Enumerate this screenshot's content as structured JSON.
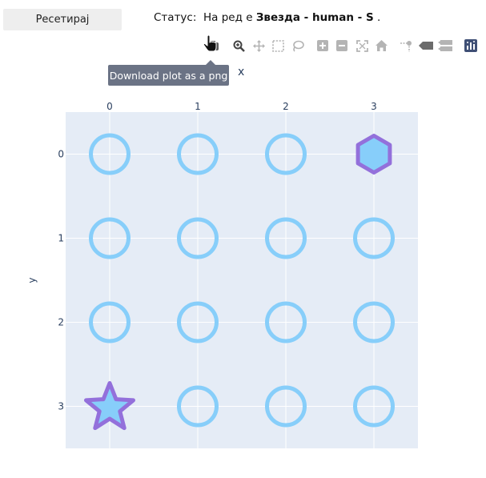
{
  "reset_button": {
    "label": "Ресетирај"
  },
  "status": {
    "prefix": "Статус:",
    "middle": "На ред е",
    "player": "Звезда - human - S",
    "suffix": "."
  },
  "modebar": {
    "buttons": [
      {
        "name": "camera-icon",
        "title": "Download plot as a png"
      },
      {
        "name": "zoom-icon",
        "title": "Zoom"
      },
      {
        "name": "pan-icon",
        "title": "Pan"
      },
      {
        "name": "box-select-icon",
        "title": "Box Select"
      },
      {
        "name": "lasso-select-icon",
        "title": "Lasso Select"
      },
      {
        "name": "zoom-in-icon",
        "title": "Zoom in"
      },
      {
        "name": "zoom-out-icon",
        "title": "Zoom out"
      },
      {
        "name": "autoscale-icon",
        "title": "Autoscale"
      },
      {
        "name": "reset-axes-icon",
        "title": "Reset axes"
      },
      {
        "name": "spike-lines-icon",
        "title": "Toggle Spike Lines"
      },
      {
        "name": "hover-closest-icon",
        "title": "Show closest data on hover"
      },
      {
        "name": "hover-compare-icon",
        "title": "Compare data on hover"
      },
      {
        "name": "plotly-logo-icon",
        "title": "Produced with Plotly"
      }
    ]
  },
  "tooltip": {
    "text": "Download plot as a png"
  },
  "chart_data": {
    "type": "scatter",
    "xlabel": "x",
    "ylabel": "y",
    "x_ticks": [
      "0",
      "1",
      "2",
      "3"
    ],
    "y_ticks": [
      "0",
      "1",
      "2",
      "3"
    ],
    "x_range": [
      -0.5,
      3.5
    ],
    "y_range": [
      3.5,
      -0.5
    ],
    "grid": true,
    "colors": {
      "empty": "#87cefa",
      "player": "#9370db",
      "fill": "#87cefa",
      "background": "#e5ecf6"
    },
    "cells": [
      {
        "x": 0,
        "y": 0,
        "symbol": "circle-open"
      },
      {
        "x": 1,
        "y": 0,
        "symbol": "circle-open"
      },
      {
        "x": 2,
        "y": 0,
        "symbol": "circle-open"
      },
      {
        "x": 3,
        "y": 0,
        "symbol": "hexagon"
      },
      {
        "x": 0,
        "y": 1,
        "symbol": "circle-open"
      },
      {
        "x": 1,
        "y": 1,
        "symbol": "circle-open"
      },
      {
        "x": 2,
        "y": 1,
        "symbol": "circle-open"
      },
      {
        "x": 3,
        "y": 1,
        "symbol": "circle-open"
      },
      {
        "x": 0,
        "y": 2,
        "symbol": "circle-open"
      },
      {
        "x": 1,
        "y": 2,
        "symbol": "circle-open"
      },
      {
        "x": 2,
        "y": 2,
        "symbol": "circle-open"
      },
      {
        "x": 3,
        "y": 2,
        "symbol": "circle-open"
      },
      {
        "x": 0,
        "y": 3,
        "symbol": "star"
      },
      {
        "x": 1,
        "y": 3,
        "symbol": "circle-open"
      },
      {
        "x": 2,
        "y": 3,
        "symbol": "circle-open"
      },
      {
        "x": 3,
        "y": 3,
        "symbol": "circle-open"
      }
    ]
  }
}
